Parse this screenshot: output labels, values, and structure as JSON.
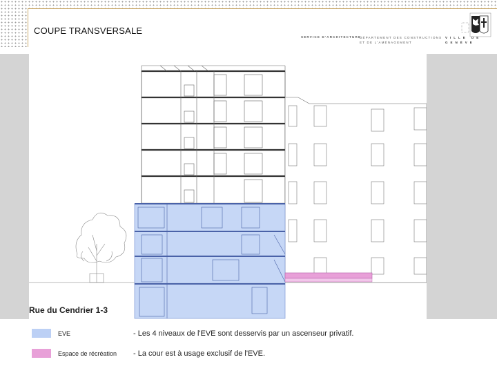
{
  "header": {
    "title": "COUPE TRANSVERSALE",
    "service": "SERVICE D'ARCHITECTURE",
    "department_line1": "DÉPARTEMENT DES CONSTRUCTIONS",
    "department_line2": "ET DE L'AMÉNAGEMENT",
    "ville_line1": "VILLE DE",
    "ville_line2": "GENÈVE"
  },
  "drawing": {
    "street_label": "Rue du Cendrier 1-3"
  },
  "legend": [
    {
      "label": "EVE",
      "color": "#bcd0f5"
    },
    {
      "label": "Espace de récréation",
      "color": "#e8a0d8"
    }
  ],
  "notes": [
    "- Les 4 niveaux de l'EVE sont desservis par un ascenseur privatif.",
    "- La cour est à usage exclusif de l'EVE."
  ],
  "colors": {
    "eve_fill": "#bcd0f5",
    "eve_stroke": "#7d97d6",
    "recreation_fill": "#e8a0d8",
    "header_border": "#c9a86a",
    "margin_gray": "#d4d4d4"
  }
}
